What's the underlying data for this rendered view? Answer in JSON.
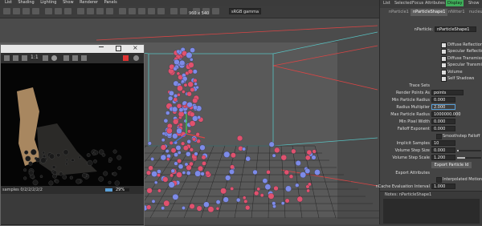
{
  "menu": [
    "List",
    "Shading",
    "Lighting",
    "Show",
    "Renderer",
    "Panels"
  ],
  "right_menu": [
    "List",
    "Selected",
    "Focus",
    "Attributes"
  ],
  "display_badge": "Display",
  "show_label": "Show",
  "colorspace": "sRGB gamma",
  "resolution": "960 x 540",
  "tabs": [
    "nParticle1",
    "nParticleShape1",
    "nNitter1",
    "nucleus1"
  ],
  "node": {
    "label": "nParticle:",
    "value": "nParticleShape1"
  },
  "checkboxes": [
    {
      "label": "Diffuse Reflection",
      "checked": true
    },
    {
      "label": "Specular Reflection",
      "checked": true
    },
    {
      "label": "Diffuse Transmission",
      "checked": true
    },
    {
      "label": "Specular Transmission",
      "checked": true
    },
    {
      "label": "Volume",
      "checked": true
    },
    {
      "label": "Self Shadows",
      "checked": true
    }
  ],
  "trace_sets": "Trace Sets",
  "render_points_as": {
    "label": "Render Points As",
    "value": "points"
  },
  "fields": [
    {
      "label": "Min Particle Radius",
      "value": "0.000"
    },
    {
      "label": "Radius Multiplier",
      "value": "2.000"
    },
    {
      "label": "Max Particle Radius",
      "value": "1000000.000"
    },
    {
      "label": "Min Pixel Width",
      "value": "0.000"
    },
    {
      "label": "Falloff Exponent",
      "value": "0.000"
    }
  ],
  "smoothstep": "Smoothstep Falloff",
  "implicit": {
    "label": "Implicit Samples",
    "value": "10"
  },
  "vol_step": {
    "label": "Volume Step Size",
    "value": "0.000"
  },
  "vol_scale": {
    "label": "Volume Step Scale",
    "value": "1.200"
  },
  "export_btn": "Export Particle Id",
  "export_attrs": "Export Attributes",
  "interp": "Interpolated Motion Bl",
  "ncache": {
    "label": "nCache Evaluation Interval",
    "value": "1.000"
  },
  "notes": "Notes: nParticleShape1",
  "render_window": {
    "status": "samples 0/2/2/2/2/2",
    "progress_pct": 29,
    "progress_text": "29%",
    "ratio": "1:1"
  },
  "colors": {
    "accent": "#5aa0d8",
    "particle_red": "#e0526e",
    "particle_blue": "#7d8be8",
    "display_green": "#3fae5a"
  }
}
